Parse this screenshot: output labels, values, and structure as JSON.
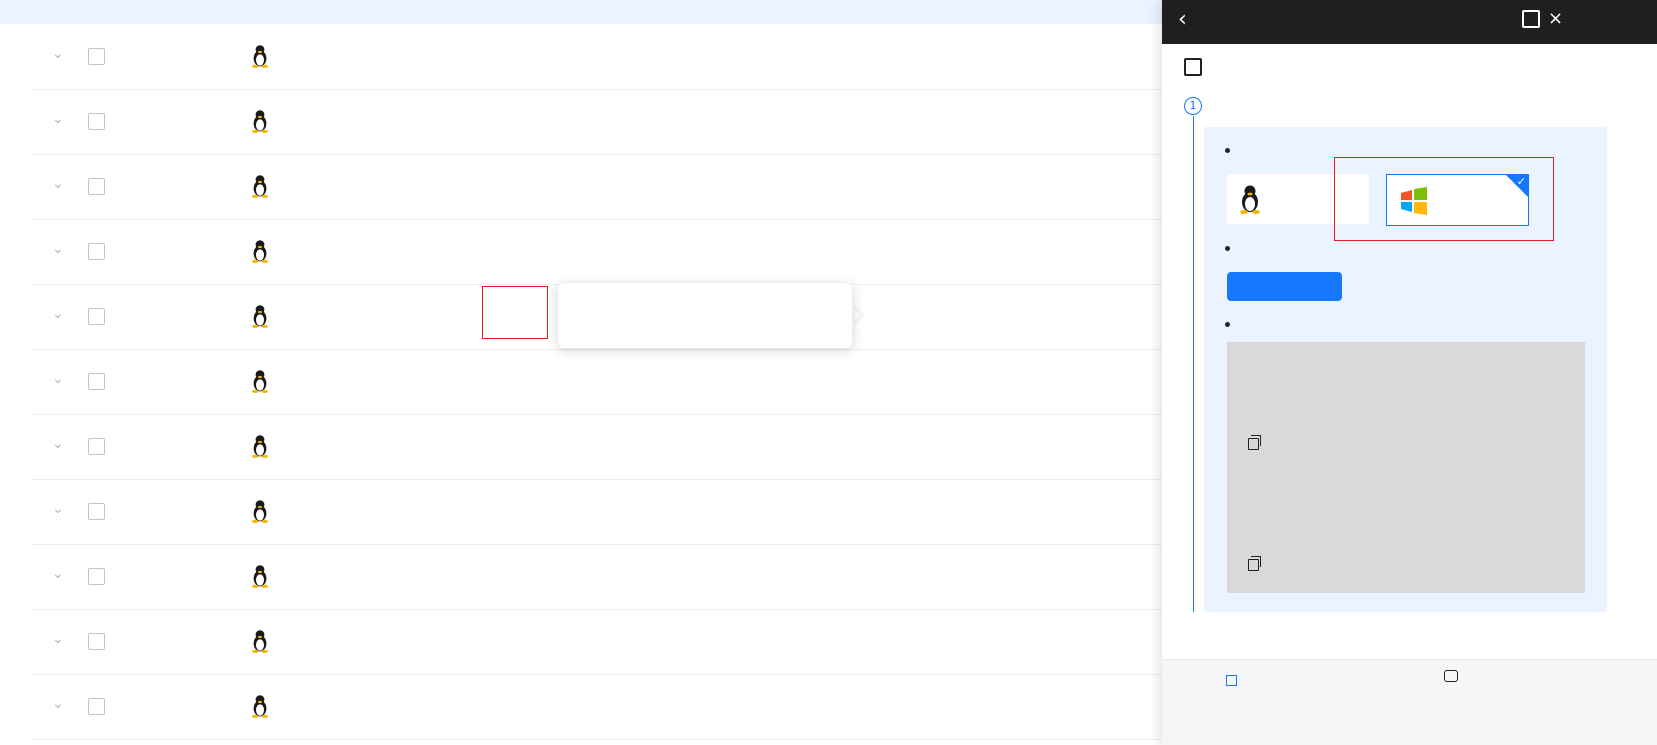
{
  "notice": {
    "text": "",
    "link": ""
  },
  "rows": [
    {
      "name": "",
      "id": "",
      "os": "",
      "ip1": "",
      "ip2": "",
      "status": "",
      "agent": "",
      "version": "",
      "cpu": "",
      "mem": "",
      "disk": "",
      "vpc": "",
      "ep": "",
      "spec": "",
      "cpu_pct": 0,
      "mem_pct": 0,
      "disk_pct": 0
    },
    {
      "name": "",
      "id": "",
      "os": "",
      "ip1": "",
      "ip2": "",
      "status": "",
      "agent": "",
      "version": "",
      "cpu": "",
      "mem": "",
      "disk": "",
      "vpc": "",
      "ep": "",
      "spec": "",
      "cpu_pct": 0,
      "mem_pct": 0,
      "disk_pct": 0
    },
    {
      "name": "",
      "id": "",
      "os": "",
      "ip1": "",
      "ip2": "",
      "status": "",
      "agent": "",
      "version": "",
      "cpu": "",
      "mem": "",
      "disk": "",
      "vpc": "",
      "ep": "",
      "spec": "",
      "cpu_pct": 0,
      "mem_pct": 0,
      "disk_pct": 0
    },
    {
      "name": "",
      "id": "",
      "os": "",
      "ip1": "",
      "ip2": "",
      "status": "",
      "agent": "",
      "version": "",
      "cpu": "",
      "mem": "",
      "disk": "",
      "vpc": "",
      "ep": "",
      "spec": "",
      "cpu_pct": 0,
      "mem_pct": 0,
      "disk_pct": 0
    },
    {
      "name": "",
      "id": "",
      "os": "",
      "ip1": "",
      "ip2": "",
      "status": "",
      "agent": "",
      "version": "",
      "cpu": "",
      "mem": "",
      "disk": "",
      "vpc": "",
      "ep": "",
      "spec": "",
      "cpu_pct": 0,
      "mem_pct": 0,
      "disk_pct": 0
    },
    {
      "name": "",
      "id": "",
      "os": "",
      "ip1": "",
      "ip2": "",
      "status": "",
      "agent": "",
      "version": "",
      "cpu": "",
      "mem": "",
      "disk": "",
      "vpc": "",
      "ep": "",
      "spec": "",
      "cpu_pct": 0,
      "mem_pct": 0,
      "disk_pct": 0
    },
    {
      "name": "",
      "id": "",
      "os": "",
      "ip1": "",
      "ip2": "",
      "status": "",
      "agent": "",
      "version": "",
      "cpu": "",
      "mem": "",
      "disk": "",
      "vpc": "",
      "ep": "",
      "spec": "",
      "cpu_pct": 0,
      "mem_pct": 0,
      "disk_pct": 0
    },
    {
      "name": "",
      "id": "",
      "os": "",
      "ip1": "",
      "ip2": "",
      "status": "",
      "agent": "",
      "version": "",
      "cpu": "",
      "mem": "",
      "disk": "",
      "vpc": "",
      "ep": "",
      "spec": "",
      "cpu_pct": 0,
      "mem_pct": 0,
      "disk_pct": 0
    },
    {
      "name": "",
      "id": "",
      "os": "",
      "ip1": "",
      "ip2": "",
      "status": "",
      "agent": "",
      "version": "",
      "cpu": "",
      "mem": "",
      "disk": "",
      "vpc": "",
      "ep": "",
      "spec": "",
      "cpu_pct": 0,
      "mem_pct": 0,
      "disk_pct": 0
    },
    {
      "name": "",
      "id": "",
      "os": "",
      "ip1": "",
      "ip2": "",
      "status": "",
      "agent": "",
      "version": "",
      "cpu": "",
      "mem": "",
      "disk": "",
      "vpc": "",
      "ep": "",
      "spec": "",
      "cpu_pct": 0,
      "mem_pct": 0,
      "disk_pct": 0
    },
    {
      "name": "",
      "id": "",
      "os": "",
      "ip1": "",
      "ip2": "",
      "status": "",
      "agent": "",
      "version": "",
      "cpu": "",
      "mem": "",
      "disk": "",
      "vpc": "",
      "ep": "",
      "spec": "",
      "cpu_pct": 0,
      "mem_pct": 0,
      "disk_pct": 0
    }
  ],
  "tooltip": {
    "text": ""
  },
  "panel": {
    "title": "",
    "section_title": "",
    "step1_title": "",
    "bullet_os": "",
    "os_linux": "",
    "os_windows": "",
    "bullet_method": "",
    "install_button": "",
    "bullet_usage": "",
    "code": {
      "download_title": "",
      "download_desc": "",
      "url_line1": "",
      "url_line2": "",
      "powershell_title": "",
      "exec_desc": "",
      "cmd_line1": "",
      "cmd_line2": ""
    },
    "footer_link": "",
    "footer_cs": ""
  },
  "colors": {
    "accent": "#1677ff",
    "running": "#3fc98c",
    "stopped": "#5a5d66",
    "fault": "#f04a4a",
    "panel_header": "#1f1f1f",
    "highlight": "#e02020"
  }
}
